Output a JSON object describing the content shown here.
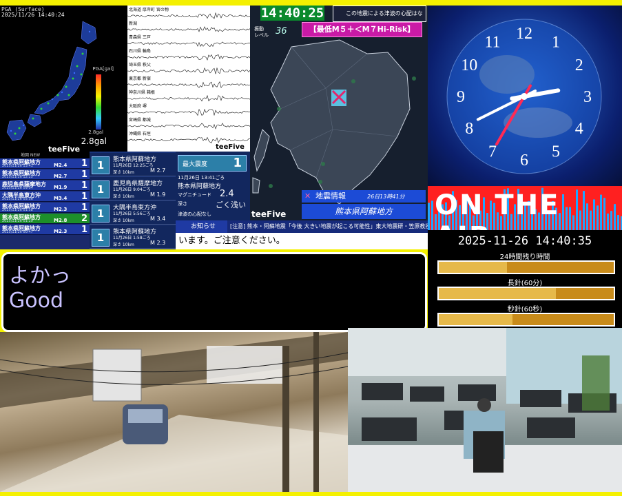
{
  "pga_map": {
    "timestamp_label": "PGA (Surface)",
    "timestamp": "2025/11/26 14:40:24",
    "scale_label": "PGA[gal]",
    "gal_small": "2.8gal",
    "gal_value": "2.8gal",
    "brand": "teeFive",
    "list_header": "地図 NEW"
  },
  "seismograms": {
    "stations": [
      "北海道 厚岸町 宮の物",
      "新潟",
      "青森県 三戸",
      "石川県 輪島",
      "埼玉県 秩父",
      "東京都 新宿",
      "神奈川県 箱根",
      "大阪府 堺",
      "宮崎県 都城",
      "沖縄県 石垣"
    ],
    "brand": "teeFive"
  },
  "kyushu": {
    "clock": "14:40:25",
    "notice": "この地震による津波の心配はなし",
    "level_label_1": "振動",
    "level_label_2": "レベル",
    "level_value": "36",
    "risk_label": "【最低M５＋＜M７Hi-Risk】",
    "info_header": "地震情報",
    "info_time": "26日13時41分",
    "info_region": "熊本県阿蘇地方",
    "brand": "teeFive"
  },
  "clock": {
    "numbers": [
      "12",
      "1",
      "2",
      "3",
      "4",
      "5",
      "6",
      "7",
      "8",
      "9",
      "10",
      "11"
    ],
    "time_display": "14:40:35",
    "accent_color": "#ff2a55"
  },
  "on_air": {
    "text": "ON THE AIR"
  },
  "event_list": [
    {
      "location": "熊本県阿蘇地方",
      "datetime": "2025/11/26 13:41",
      "magnitude": "M2.4",
      "intensity": "1"
    },
    {
      "location": "熊本県阿蘇地方",
      "datetime": "2025/11/26 12:25",
      "magnitude": "M2.7",
      "intensity": "1"
    },
    {
      "location": "鹿児島県薩摩地方",
      "datetime": "2025/11/26 09:04",
      "magnitude": "M1.9",
      "intensity": "1"
    },
    {
      "location": "大隅半島東方沖",
      "datetime": "2025/11/26 05:56",
      "magnitude": "M3.4",
      "intensity": "1"
    },
    {
      "location": "熊本県阿蘇地方",
      "datetime": "2025/11/26 01:58",
      "magnitude": "M2.3",
      "intensity": "1"
    },
    {
      "location": "熊本県阿蘇地方",
      "datetime": "2025/11/26 01:29",
      "magnitude": "M2.8",
      "intensity": "2",
      "selected": true
    },
    {
      "location": "熊本県阿蘇地方",
      "datetime": "2025/11/26 00:47",
      "magnitude": "M2.3",
      "intensity": "1"
    }
  ],
  "event_detail": [
    {
      "intensity": "1",
      "location": "熊本県阿蘇地方",
      "datetime": "11月26日 12:25ごろ",
      "depth": "深さ 10km",
      "magnitude": "M 2.7"
    },
    {
      "intensity": "1",
      "location": "鹿児島県薩摩地方",
      "datetime": "11月26日 9:04ごろ",
      "depth": "深さ 10km",
      "magnitude": "M 1.9"
    },
    {
      "intensity": "1",
      "location": "大隅半島東方沖",
      "datetime": "11月26日 5:56ごろ",
      "depth": "深さ 10km",
      "magnitude": "M 3.4"
    },
    {
      "intensity": "1",
      "location": "熊本県阿蘇地方",
      "datetime": "11月26日 1:58ごろ",
      "depth": "深さ 10km",
      "magnitude": "M 2.3"
    }
  ],
  "max_intensity": {
    "label": "最大震度",
    "value": "1",
    "datetime": "11月26日 13:41ごろ",
    "region": "熊本県阿蘇地方",
    "mag_label": "マグニチュード",
    "mag_value": "2.4",
    "depth_label": "深さ",
    "depth_value": "ごく浅い",
    "tsunami": "津波の心配なし"
  },
  "ticker": {
    "label": "お知らせ",
    "text": "[注意] 熊本・阿蘇地震「今後 大きい地震が起こる可能性」東大地震研・笠原教授",
    "line2": "います。ご注意ください。"
  },
  "chat": {
    "line1": "よかっ",
    "line2": "Good"
  },
  "timers": {
    "datetime": "2025-11-26 14:40:35",
    "bars": [
      {
        "label": "24時間残り時間",
        "icon": "clock-icon",
        "value": 0.39
      },
      {
        "label": "長針(60分)",
        "icon": "minute-icon",
        "value": 0.67
      },
      {
        "label": "秒針(60秒)",
        "icon": "hourglass-icon",
        "value": 0.42
      }
    ]
  }
}
